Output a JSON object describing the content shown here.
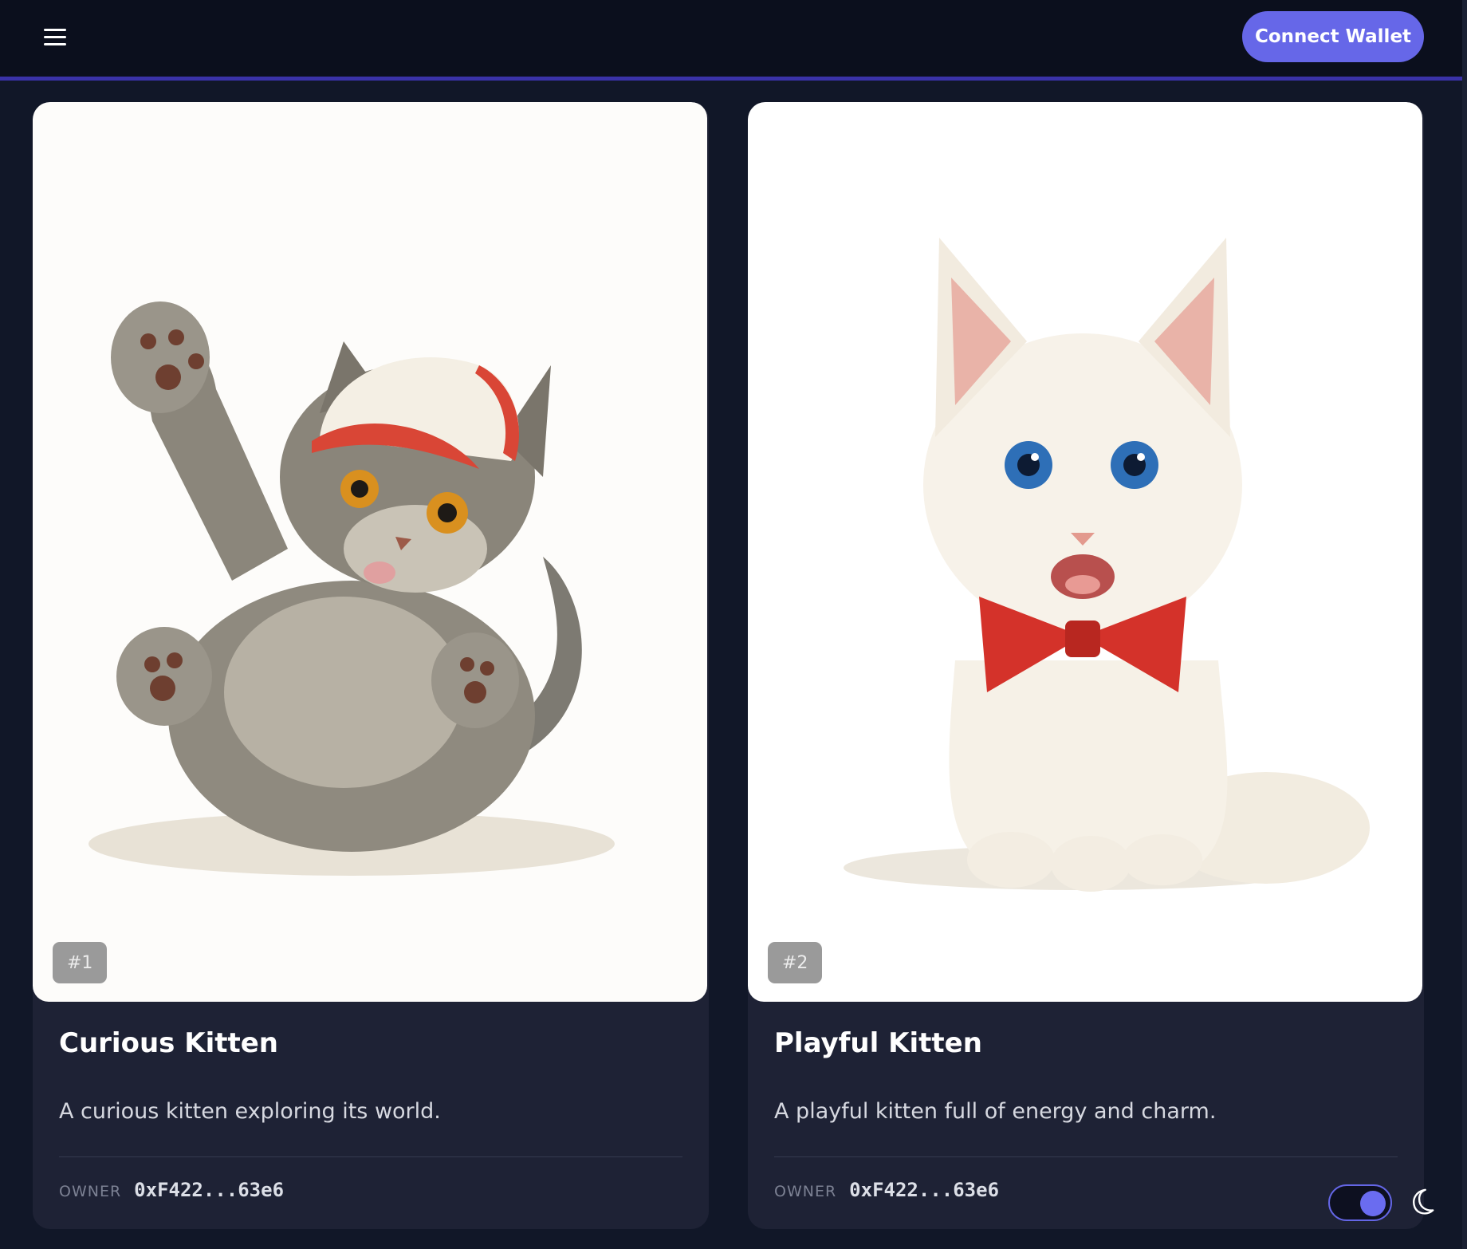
{
  "header": {
    "connect_label": "Connect Wallet"
  },
  "cards": [
    {
      "token": "#1",
      "title": "Curious Kitten",
      "description": "A curious kitten exploring its world.",
      "owner_label": "OWNER",
      "owner_address": "0xF422...63e6"
    },
    {
      "token": "#2",
      "title": "Playful Kitten",
      "description": "A playful kitten full of energy and charm.",
      "owner_label": "OWNER",
      "owner_address": "0xF422...63e6"
    }
  ],
  "theme_toggle": {
    "mode": "dark",
    "on": true
  },
  "colors": {
    "background": "#111728",
    "header": "#0b0f1d",
    "accent": "#6667e8",
    "card": "#1e2235"
  }
}
